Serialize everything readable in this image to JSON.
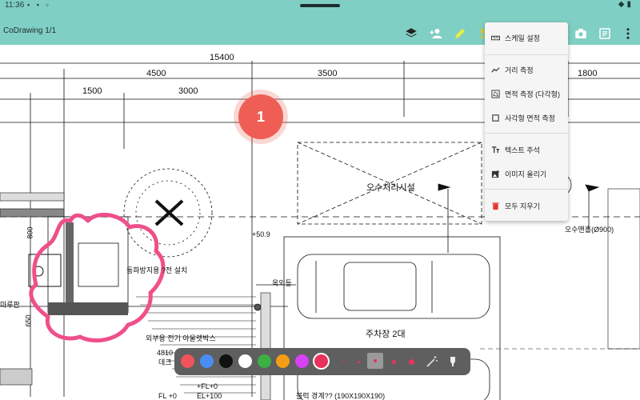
{
  "status_bar": {
    "time": "11:36",
    "left_icons": "▪ ▪ ▫",
    "right_icons": "◆▮"
  },
  "app_bar": {
    "title": "CoDrawing 1/1"
  },
  "toolbar": [
    {
      "name": "layers-icon"
    },
    {
      "name": "add-user-icon"
    },
    {
      "name": "pencil-icon"
    },
    {
      "name": "pen-icon"
    },
    {
      "name": "camera-icon"
    },
    {
      "name": "document-icon"
    },
    {
      "name": "more-vert-icon"
    }
  ],
  "dropdown_menu": {
    "groups": [
      [
        {
          "label": "스케일 설정",
          "icon": "ruler-icon"
        }
      ],
      [
        {
          "label": "거리 측정",
          "icon": "measure-line-icon"
        },
        {
          "label": "면적 측정 (다각형)",
          "icon": "polygon-area-icon"
        },
        {
          "label": "사각형 면적 측정",
          "icon": "rectangle-area-icon"
        }
      ],
      [
        {
          "label": "텍스트 주석",
          "icon": "text-icon"
        },
        {
          "label": "이미지 올리기",
          "icon": "image-upload-icon"
        }
      ],
      [
        {
          "label": "모두 지우기",
          "icon": "trash-icon"
        }
      ]
    ]
  },
  "drawing": {
    "dimensions": [
      "15400",
      "4500",
      "3500",
      "1800",
      "1500",
      "3000",
      "800",
      "650",
      "4810"
    ],
    "labels": {
      "septic": "오수처리시설",
      "parking": "주차장 2대",
      "outdoor_light": "옥외등",
      "sewer_manhole": "오수맨홀(Ø900)",
      "level": "+50.9",
      "insulation": "동파방지용 ?전 설치",
      "heater": "외부용 전기 아울렛박스",
      "deck": "데크",
      "fl": "FL +0",
      "el": "EL +10",
      "left_floor": "마루판",
      "block": "블럭 경계?? (190X190X190)",
      "plus_fl": "+FL+0",
      "plus_el": "EL+100"
    },
    "badge": "1"
  },
  "palette": {
    "colors": [
      {
        "name": "red",
        "hex": "#f0545a"
      },
      {
        "name": "blue",
        "hex": "#4a8ef5"
      },
      {
        "name": "black",
        "hex": "#111111"
      },
      {
        "name": "white",
        "hex": "#ffffff"
      },
      {
        "name": "green",
        "hex": "#3cb043"
      },
      {
        "name": "orange",
        "hex": "#f59d16"
      },
      {
        "name": "purple",
        "hex": "#d742f5"
      },
      {
        "name": "pink",
        "hex": "#e8325c"
      }
    ],
    "selected_color": "pink",
    "brush_sizes": [
      "xs",
      "s",
      "m",
      "l",
      "xl"
    ],
    "selected_size": "m",
    "tools": [
      "magic-wand-icon",
      "highlighter-icon"
    ]
  },
  "colors": {
    "appbar": "#80cfc4",
    "annotation": "#ef4f8a",
    "badge": "#ef5e55"
  }
}
